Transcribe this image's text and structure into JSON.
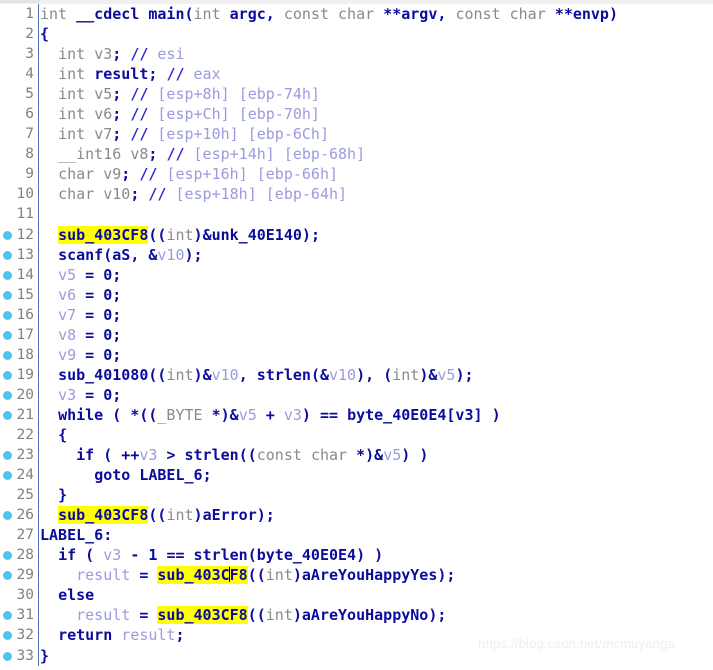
{
  "app": {
    "view_name": "Pseudocode",
    "watermark": "https://blog.csdn.net/mcmuyanga"
  },
  "colors": {
    "background": "#ffffff",
    "gutter_number": "#808080",
    "separator": "#4a72b8",
    "breakpoint_dot": "#4ec3f0",
    "keyword": "#0b0b9e",
    "variable": "#9a9ae0",
    "type_gray": "#8a8a8a",
    "comment_marker": "#2d2dd6",
    "highlight_bg": "#ffff00",
    "caret": "#000000",
    "watermark": "#eceff1"
  },
  "highlighted_identifier": "sub_403CF8",
  "lines": [
    {
      "n": "1",
      "dot": false,
      "text": "int __cdecl main(int argc, const char **argv, const char **envp)"
    },
    {
      "n": "2",
      "dot": false,
      "text": "{"
    },
    {
      "n": "3",
      "dot": false,
      "text": "  int v3; // esi"
    },
    {
      "n": "4",
      "dot": false,
      "text": "  int result; // eax"
    },
    {
      "n": "5",
      "dot": false,
      "text": "  int v5; // [esp+8h] [ebp-74h]"
    },
    {
      "n": "6",
      "dot": false,
      "text": "  int v6; // [esp+Ch] [ebp-70h]"
    },
    {
      "n": "7",
      "dot": false,
      "text": "  int v7; // [esp+10h] [ebp-6Ch]"
    },
    {
      "n": "8",
      "dot": false,
      "text": "  __int16 v8; // [esp+14h] [ebp-68h]"
    },
    {
      "n": "9",
      "dot": false,
      "text": "  char v9; // [esp+16h] [ebp-66h]"
    },
    {
      "n": "10",
      "dot": false,
      "text": "  char v10; // [esp+18h] [ebp-64h]"
    },
    {
      "n": "11",
      "dot": false,
      "text": ""
    },
    {
      "n": "12",
      "dot": true,
      "text": "  sub_403CF8((int)&unk_40E140);"
    },
    {
      "n": "13",
      "dot": true,
      "text": "  scanf(aS, &v10);"
    },
    {
      "n": "14",
      "dot": true,
      "text": "  v5 = 0;"
    },
    {
      "n": "15",
      "dot": true,
      "text": "  v6 = 0;"
    },
    {
      "n": "16",
      "dot": true,
      "text": "  v7 = 0;"
    },
    {
      "n": "17",
      "dot": true,
      "text": "  v8 = 0;"
    },
    {
      "n": "18",
      "dot": true,
      "text": "  v9 = 0;"
    },
    {
      "n": "19",
      "dot": true,
      "text": "  sub_401080((int)&v10, strlen(&v10), (int)&v5);"
    },
    {
      "n": "20",
      "dot": true,
      "text": "  v3 = 0;"
    },
    {
      "n": "21",
      "dot": true,
      "text": "  while ( *((_BYTE *)&v5 + v3) == byte_40E0E4[v3] )"
    },
    {
      "n": "22",
      "dot": false,
      "text": "  {"
    },
    {
      "n": "23",
      "dot": true,
      "text": "    if ( ++v3 > strlen((const char *)&v5) )"
    },
    {
      "n": "24",
      "dot": true,
      "text": "      goto LABEL_6;"
    },
    {
      "n": "25",
      "dot": false,
      "text": "  }"
    },
    {
      "n": "26",
      "dot": true,
      "text": "  sub_403CF8((int)aError);"
    },
    {
      "n": "27",
      "dot": false,
      "text": "LABEL_6:"
    },
    {
      "n": "28",
      "dot": true,
      "text": "  if ( v3 - 1 == strlen(byte_40E0E4) )"
    },
    {
      "n": "29",
      "dot": true,
      "text": "    result = sub_403CF8((int)aAreYouHappyYes);"
    },
    {
      "n": "30",
      "dot": false,
      "text": "  else"
    },
    {
      "n": "31",
      "dot": true,
      "text": "    result = sub_403CF8((int)aAreYouHappyNo);"
    },
    {
      "n": "32",
      "dot": true,
      "text": "  return result;"
    },
    {
      "n": "33",
      "dot": true,
      "text": "}"
    }
  ],
  "caret": {
    "line": "29",
    "before": "sub_403C",
    "after": "F8"
  },
  "identifiers": {
    "function_name": "main",
    "calling_convention": "__cdecl",
    "called_functions": [
      "sub_403CF8",
      "scanf",
      "sub_401080",
      "strlen"
    ],
    "data_refs": [
      "unk_40E140",
      "aS",
      "byte_40E0E4",
      "aError",
      "aAreYouHappyYes",
      "aAreYouHappyNo"
    ],
    "label": "LABEL_6",
    "locals": [
      "v3",
      "result",
      "v5",
      "v6",
      "v7",
      "v8",
      "v9",
      "v10"
    ],
    "registers": [
      "esi",
      "eax"
    ],
    "stack_comments": [
      "[esp+8h] [ebp-74h]",
      "[esp+Ch] [ebp-70h]",
      "[esp+10h] [ebp-6Ch]",
      "[esp+14h] [ebp-68h]",
      "[esp+16h] [ebp-66h]",
      "[esp+18h] [ebp-64h]"
    ]
  }
}
